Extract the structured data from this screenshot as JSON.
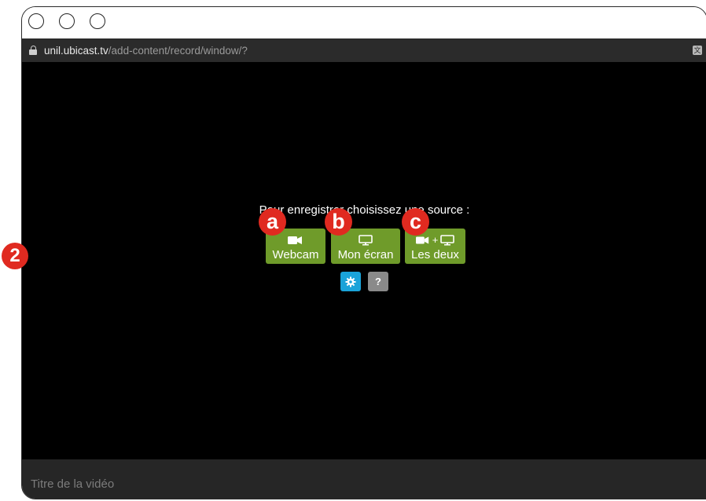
{
  "browser": {
    "url_host": "unil.ubicast.tv",
    "url_path": "/add-content/record/window/?",
    "translate_icon": "translate-icon"
  },
  "recorder": {
    "prompt": "Pour enregistrer choisissez une source :",
    "sources": [
      {
        "label": "Webcam",
        "icon": "camera-icon"
      },
      {
        "label": "Mon écran",
        "icon": "monitor-icon"
      },
      {
        "label": "Les deux",
        "icon": "camera-plus-monitor-icon",
        "plus": "+"
      }
    ],
    "settings_icon": "gear-icon",
    "help_label": "?"
  },
  "footer": {
    "title_placeholder": "Titre de la vidéo"
  },
  "annotations": {
    "step": "2",
    "labels": [
      "a",
      "b",
      "c"
    ],
    "badge_color": "#e02a20"
  },
  "colors": {
    "source_button": "#6f9b2a",
    "settings_button": "#1aa3d9",
    "help_button": "#8a8a8a",
    "address_bar": "#2b2b2b",
    "footer": "#262626"
  }
}
